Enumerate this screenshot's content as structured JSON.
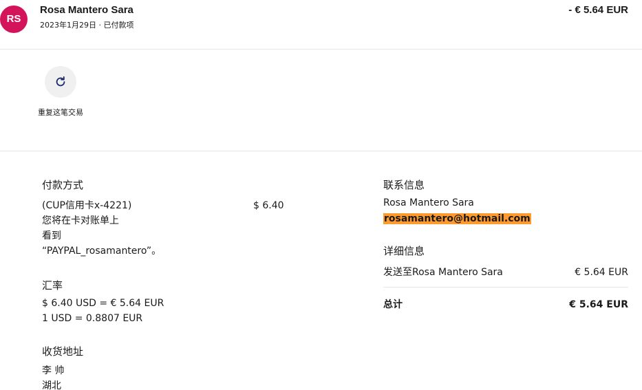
{
  "header": {
    "avatar_initials": "RS",
    "avatar_color": "#d4145a",
    "name": "Rosa Mantero Sara",
    "subline": "2023年1月29日 · 已付款项",
    "amount": "- € 5.64 EUR"
  },
  "actions": {
    "repeat": {
      "icon": "refresh-icon",
      "label": "重复这笔交易"
    }
  },
  "payment": {
    "title": "付款方式",
    "method_lines": [
      "(CUP信用卡x-4221)",
      "您将在卡对账单上",
      "看到",
      "“PAYPAL_rosamantero”。"
    ],
    "method_amount": "$ 6.40"
  },
  "exchange": {
    "title": "汇率",
    "line1": "$ 6.40 USD = € 5.64 EUR",
    "line2": "1 USD = 0.8807 EUR"
  },
  "shipping": {
    "title": "收货地址",
    "line1": "李 帅",
    "line2": "湖北"
  },
  "contact": {
    "title": "联系信息",
    "name": "Rosa Mantero Sara",
    "email": "rosamantero@hotmail.com",
    "email_highlight_color": "#ff9a2e"
  },
  "details": {
    "title": "详细信息",
    "sent_label": "发送至Rosa Mantero Sara",
    "sent_amount": "€ 5.64 EUR",
    "total_label": "总计",
    "total_amount": "€ 5.64 EUR"
  }
}
